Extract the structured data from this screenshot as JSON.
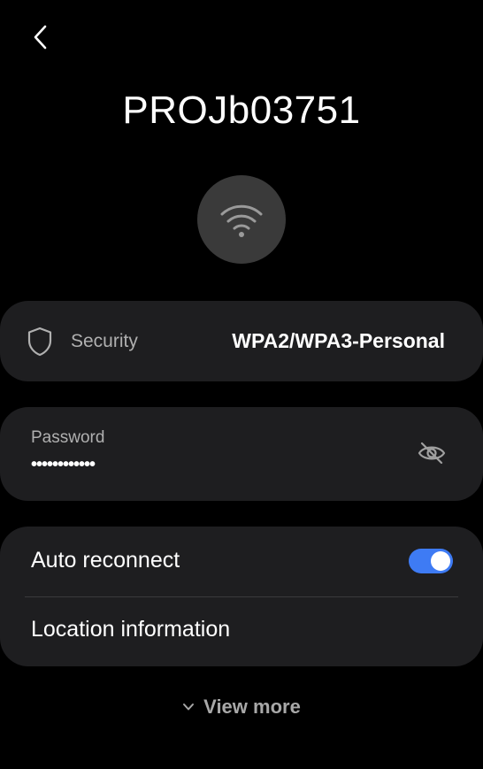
{
  "header": {
    "network_name": "PROJb03751",
    "back_icon": "chevron-left-icon",
    "network_icon": "wifi-icon"
  },
  "security": {
    "label": "Security",
    "value": "WPA2/WPA3-Personal",
    "icon": "shield-icon"
  },
  "password": {
    "label": "Password",
    "masked_value": "••••••••••••",
    "visibility_icon": "eye-off-icon"
  },
  "options": {
    "auto_reconnect": {
      "label": "Auto reconnect",
      "enabled": true
    },
    "location_information": {
      "label": "Location information"
    }
  },
  "footer": {
    "view_more_label": "View more",
    "view_more_icon": "chevron-down-icon"
  },
  "colors": {
    "background": "#000000",
    "card": "#1e1e20",
    "accent": "#3e7bf4",
    "secondary_text": "#b0b0b0"
  }
}
